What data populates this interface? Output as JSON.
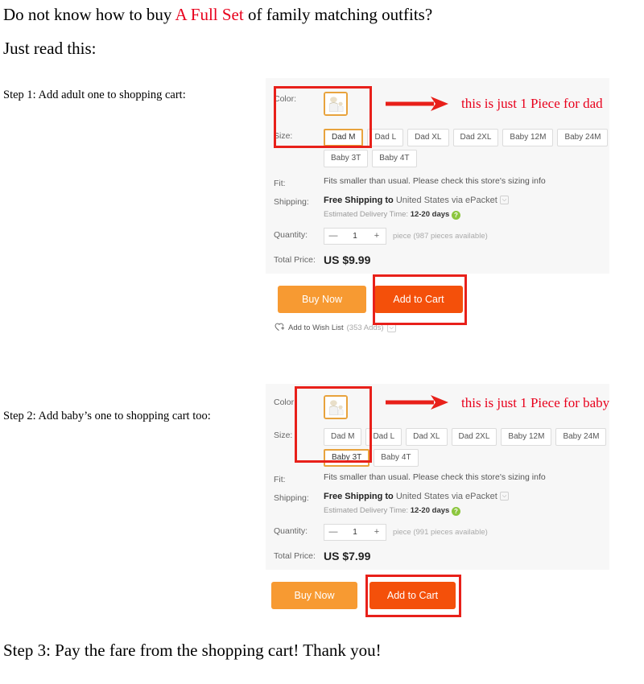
{
  "intro": {
    "title_part1": "Do not know how to buy ",
    "title_highlight": "A Full Set",
    "title_part2": " of  family matching outfits?",
    "subtitle": "Just read this:"
  },
  "steps": {
    "step1": "Step 1: Add adult one to shopping cart:",
    "step2": "Step 2: Add baby’s one to shopping cart too:",
    "step3": "Step 3: Pay the fare from the shopping cart!   Thank you!"
  },
  "annotations": {
    "dad": "this is just 1 Piece for dad",
    "baby": "this is just 1 Piece for baby",
    "arrow_color": "#e8201a",
    "box_color": "#e8201a",
    "text_color": "#e8001c"
  },
  "labels": {
    "color": "Color:",
    "size": "Size:",
    "fit": "Fit:",
    "shipping": "Shipping:",
    "quantity": "Quantity:",
    "total_price": "Total Price:"
  },
  "sizes": [
    "Dad M",
    "Dad L",
    "Dad XL",
    "Dad 2XL",
    "Baby 12M",
    "Baby 24M",
    "Baby 3T",
    "Baby 4T"
  ],
  "panel1": {
    "selected_size": "Dad M",
    "fit_text": "Fits smaller than usual. Please check this store's sizing info",
    "shipping_bold": "Free Shipping to",
    "shipping_rest": "United States via ePacket",
    "delivery_label": "Estimated Delivery Time:",
    "delivery_value": "12-20 days",
    "help_glyph": "?",
    "caret_glyph": "⌵",
    "qty_minus": "—",
    "qty_value": "1",
    "qty_plus": "+",
    "qty_note": "piece (987 pieces available)",
    "price": "US $9.99",
    "buy_now": "Buy Now",
    "add_to_cart": "Add to Cart",
    "wish_label": "Add to Wish List",
    "wish_count": "(353 Adds)"
  },
  "panel2": {
    "selected_size": "Baby 3T",
    "fit_text": "Fits smaller than usual. Please check this store's sizing info",
    "shipping_bold": "Free Shipping to",
    "shipping_rest": "United States via ePacket",
    "delivery_label": "Estimated Delivery Time:",
    "delivery_value": "12-20 days",
    "help_glyph": "?",
    "caret_glyph": "⌵",
    "qty_minus": "—",
    "qty_value": "1",
    "qty_plus": "+",
    "qty_note": "piece (991 pieces available)",
    "price": "US $7.99",
    "buy_now": "Buy Now",
    "add_to_cart": "Add to Cart"
  },
  "icons": {
    "swatch": "family-outfit-thumbnail-icon",
    "wish": "heart-plus-icon",
    "dropdown": "chevron-down-icon",
    "help": "question-mark-icon",
    "arrow": "right-arrow-icon"
  }
}
